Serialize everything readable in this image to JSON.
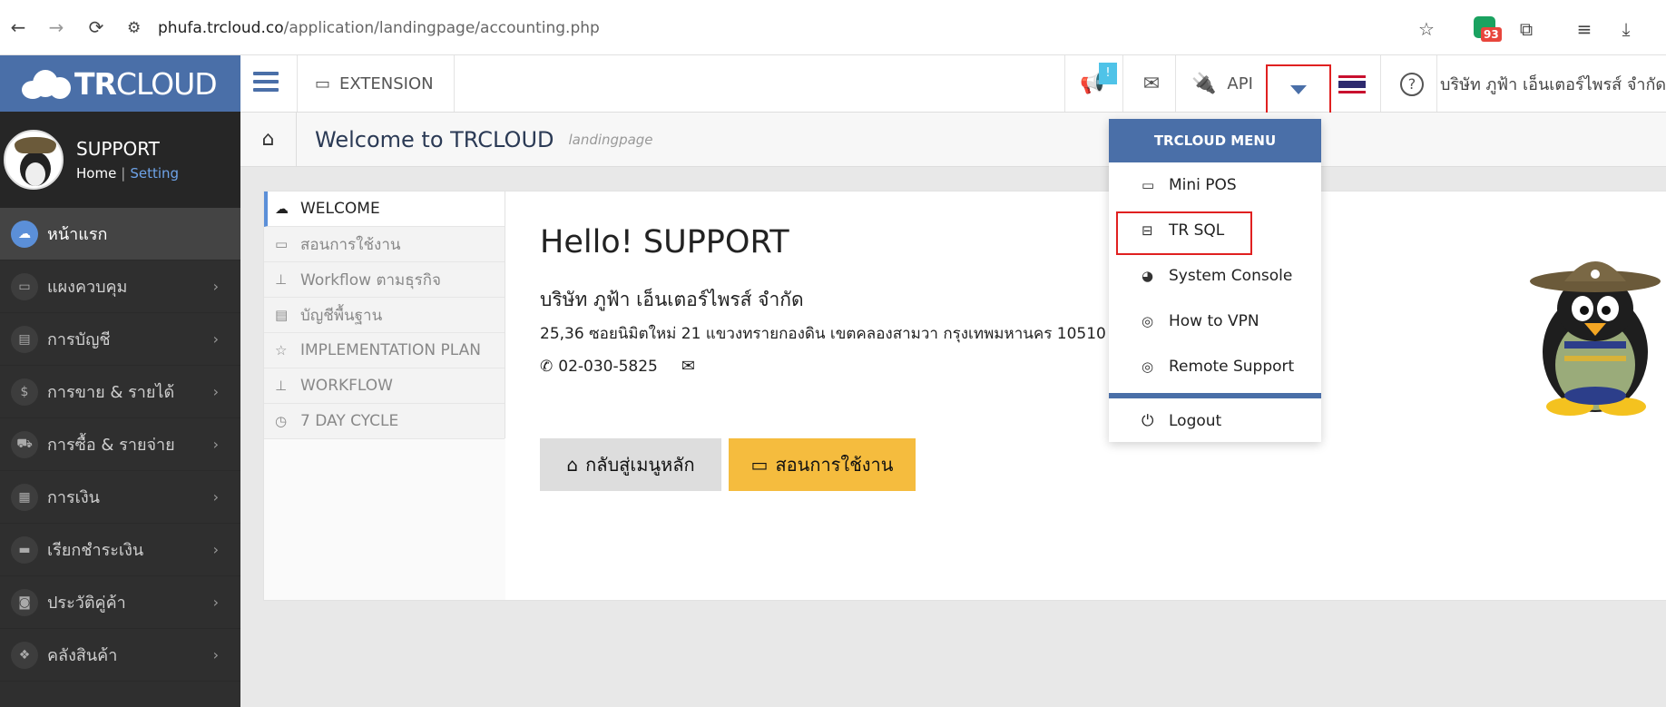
{
  "browser": {
    "url_host": "phufa.trcloud.co",
    "url_path": "/application/landingpage/accounting.php",
    "extension_badge": "93"
  },
  "sidebar": {
    "logo_bold": "TR",
    "logo_rest": "CLOUD",
    "user_name": "SUPPORT",
    "home_link": "Home",
    "setting_link": "Setting",
    "items": [
      {
        "label": "หน้าแรก",
        "icon": "cloud-icon"
      },
      {
        "label": "แผงควบคุม",
        "icon": "monitor-icon"
      },
      {
        "label": "การบัญชี",
        "icon": "book-icon"
      },
      {
        "label": "การขาย & รายได้",
        "icon": "dollar-icon"
      },
      {
        "label": "การซื้อ & รายจ่าย",
        "icon": "cart-icon"
      },
      {
        "label": "การเงิน",
        "icon": "calendar-icon"
      },
      {
        "label": "เรียกชำระเงิน",
        "icon": "card-icon"
      },
      {
        "label": "ประวัติคู่ค้า",
        "icon": "contact-icon"
      },
      {
        "label": "คลังสินค้า",
        "icon": "boxes-icon"
      }
    ]
  },
  "topbar": {
    "extension_label": "EXTENSION",
    "notify_badge": "!",
    "api_label": "API",
    "company_name": "บริษัท ภูฟ้า เอ็นเตอร์ไพรส์ จำกัด"
  },
  "page": {
    "title": "Welcome to TRCLOUD",
    "subtitle": "landingpage"
  },
  "tabs": [
    {
      "label": "WELCOME",
      "icon": "cloud-icon"
    },
    {
      "label": "สอนการใช้งาน",
      "icon": "monitor-icon"
    },
    {
      "label": "Workflow ตามธุรกิจ",
      "icon": "sitemap-icon"
    },
    {
      "label": "บัญชีพื้นฐาน",
      "icon": "book-icon"
    },
    {
      "label": "IMPLEMENTATION PLAN",
      "icon": "star-icon"
    },
    {
      "label": "WORKFLOW",
      "icon": "sitemap-icon"
    },
    {
      "label": "7 DAY CYCLE",
      "icon": "clock-icon"
    }
  ],
  "main": {
    "hello": "Hello! SUPPORT",
    "company": "บริษัท ภูฟ้า เอ็นเตอร์ไพรส์ จำกัด",
    "address": "25,36 ซอยนิมิตใหม่ 21 แขวงทรายกองดิน เขตคลองสามวา กรุงเทพมหานคร 10510",
    "phone": "02-030-5825",
    "btn_home": "กลับสู่เมนูหลัก",
    "btn_guide": "สอนการใช้งาน"
  },
  "dropdown": {
    "header": "TRCLOUD MENU",
    "items": [
      {
        "label": "Mini POS",
        "icon": "laptop-icon"
      },
      {
        "label": "TR SQL",
        "icon": "drive-icon"
      },
      {
        "label": "System Console",
        "icon": "gauge-icon"
      },
      {
        "label": "How to VPN",
        "icon": "lifering-icon"
      },
      {
        "label": "Remote Support",
        "icon": "lifering-icon"
      }
    ],
    "logout": "Logout"
  }
}
